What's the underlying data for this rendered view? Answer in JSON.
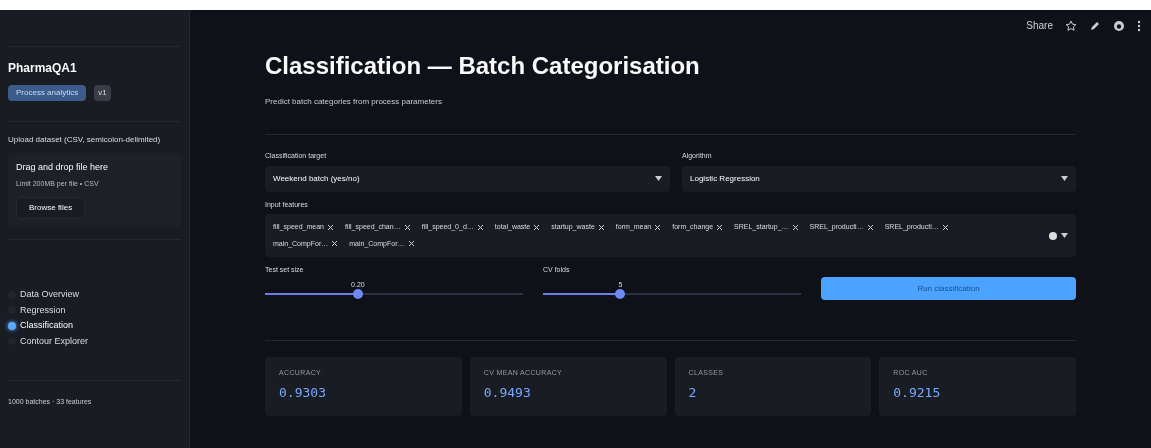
{
  "toolbar": {
    "share": "Share"
  },
  "sidebar": {
    "app_title": "PharmaQA1",
    "badges": [
      {
        "label": "Process analytics"
      },
      {
        "label": "v1"
      }
    ],
    "upload": {
      "label": "Upload dataset (CSV, semicolon-delimited)",
      "drop_text": "Drag and drop file here",
      "limit_text": "Limit 200MB per file • CSV",
      "button": "Browse files"
    },
    "nav": [
      {
        "label": "Data Overview",
        "selected": false
      },
      {
        "label": "Regression",
        "selected": false
      },
      {
        "label": "Classification",
        "selected": true
      },
      {
        "label": "Contour Explorer",
        "selected": false
      }
    ],
    "footer": "1000 batches · 33 features"
  },
  "main": {
    "title": "Classification — Batch Categorisation",
    "subtitle": "Predict batch categories from process parameters",
    "target": {
      "label": "Classification target",
      "value": "Weekend batch (yes/no)"
    },
    "algorithm": {
      "label": "Algorithm",
      "value": "Logistic Regression"
    },
    "features": {
      "label": "Input features",
      "tags": [
        "fill_speed_mean",
        "fill_speed_chan…",
        "fill_speed_0_d…",
        "total_waste",
        "startup_waste",
        "form_mean",
        "form_change",
        "SREL_startup_…",
        "SREL_producti…",
        "SREL_producti…",
        "main_CompFor…",
        "main_CompFor…"
      ]
    },
    "sliders": [
      {
        "label": "Test set size",
        "reading": "0.20",
        "level": 0.36
      },
      {
        "label": "CV folds",
        "reading": "5",
        "level": 0.3
      }
    ],
    "run_button": "Run classification",
    "metrics": [
      {
        "label": "ACCURACY",
        "value": "0.9303"
      },
      {
        "label": "CV MEAN ACCURACY",
        "value": "0.9493"
      },
      {
        "label": "CLASSES",
        "value": "2"
      },
      {
        "label": "ROC AUC",
        "value": "0.9215"
      }
    ]
  }
}
